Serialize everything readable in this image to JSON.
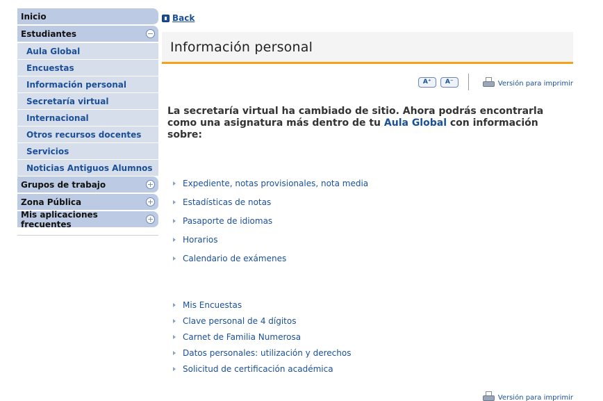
{
  "sidebar": {
    "items": [
      {
        "label": "Inicio",
        "type": "head"
      },
      {
        "label": "Estudiantes",
        "type": "head-open",
        "toggle": "−"
      },
      {
        "label": "Aula Global",
        "type": "sub"
      },
      {
        "label": "Encuestas",
        "type": "sub"
      },
      {
        "label": "Información personal",
        "type": "sub"
      },
      {
        "label": "Secretaría virtual",
        "type": "sub"
      },
      {
        "label": "Internacional",
        "type": "sub"
      },
      {
        "label": "Otros recursos docentes",
        "type": "sub"
      },
      {
        "label": "Servicios",
        "type": "sub"
      },
      {
        "label": "Noticias Antiguos Alumnos",
        "type": "sub"
      },
      {
        "label": "Grupos de trabajo",
        "type": "head",
        "toggle": "+"
      },
      {
        "label": "Zona Pública",
        "type": "head",
        "toggle": "+"
      },
      {
        "label": "Mis aplicaciones frecuentes",
        "type": "head",
        "toggle": "+"
      }
    ]
  },
  "nav": {
    "back_label": "Back"
  },
  "page": {
    "title": "Información personal"
  },
  "tools": {
    "font_increase": "A⁺",
    "font_decrease": "A⁻",
    "print_label": "Versión para imprimir"
  },
  "intro": {
    "text_before": "La secretaría virtual ha cambiado de sitio. Ahora podrás encontrarla como una asignatura más dentro de tu ",
    "link": "Aula Global",
    "text_after": " con información sobre:"
  },
  "list1": [
    "Expediente, notas provisionales, nota media",
    "Estadísticas de notas",
    "Pasaporte de idiomas",
    "Horarios",
    "Calendario de exámenes"
  ],
  "list2": [
    "Mis Encuestas",
    "Clave personal de 4 dígitos",
    "Carnet de Familia Numerosa",
    "Datos personales: utilización y derechos",
    "Solicitud de certificación académica"
  ],
  "colors": {
    "accent": "#f2a31a",
    "link": "#1a4f9a",
    "sidebar_head": "#bccbe3",
    "sidebar_sub": "#d7deeb"
  }
}
